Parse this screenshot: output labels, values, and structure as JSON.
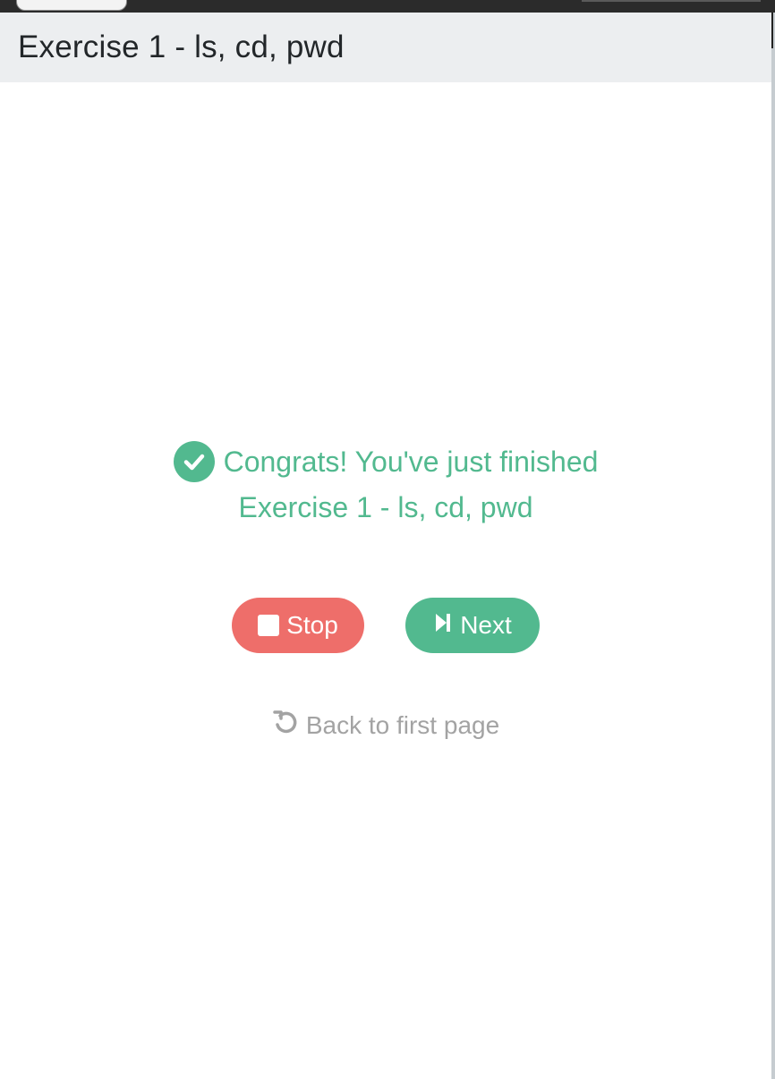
{
  "header": {
    "title": "Exercise 1 - ls, cd, pwd"
  },
  "result": {
    "congrats_line": "Congrats! You've just finished",
    "exercise_name": "Exercise 1 - ls, cd, pwd",
    "icon": "check-circle-icon"
  },
  "actions": {
    "stop_label": "Stop",
    "next_label": "Next",
    "back_label": "Back to first page",
    "stop_icon": "stop-icon",
    "next_icon": "skip-next-icon",
    "back_icon": "undo-icon"
  },
  "colors": {
    "success": "#52b98f",
    "danger": "#ee6e6a",
    "muted": "#a3a3a3",
    "header_bg": "#eceef0"
  }
}
